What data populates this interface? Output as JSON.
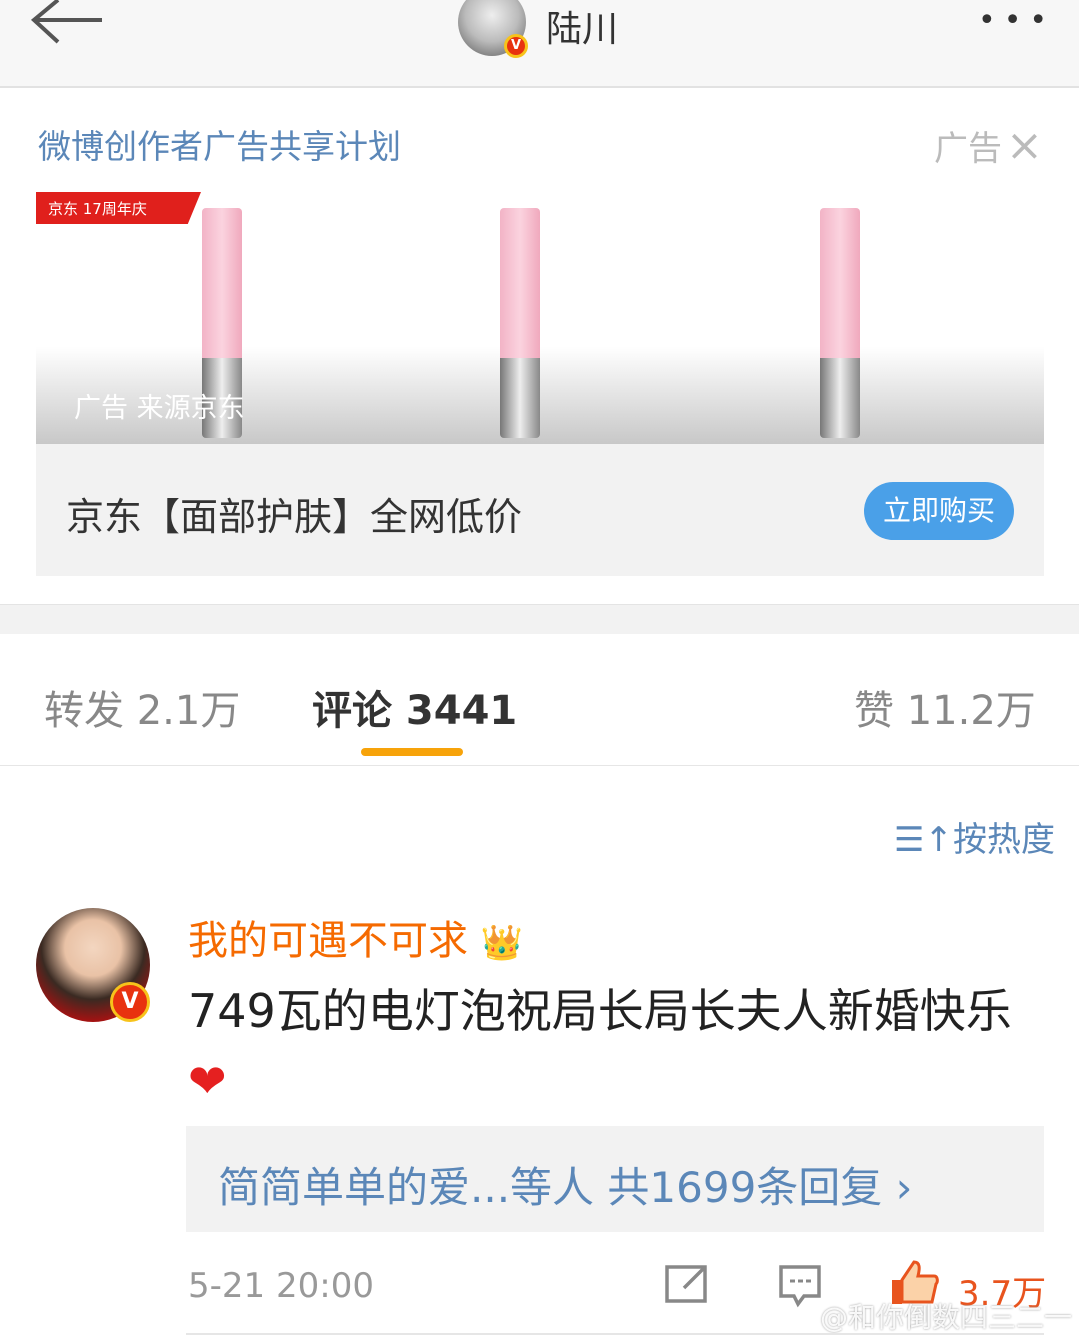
{
  "header": {
    "title": "陆川",
    "more": "•••",
    "verified": "V"
  },
  "ad": {
    "plan": "微博创作者广告共享计划",
    "tag": "广告",
    "close": "×",
    "jd_banner": "京东 17周年庆",
    "source": "广告 来源京东",
    "headline": "京东【面部护肤】全网低价",
    "buy": "立即购买"
  },
  "tabs": [
    {
      "label": "转发 2.1万"
    },
    {
      "label": "评论 3441"
    },
    {
      "label": "赞 11.2万"
    }
  ],
  "sort": "按热度",
  "comment": {
    "user": "我的可遇不可求",
    "crown": "👑",
    "text": "749瓦的电灯泡祝局长局长夫人新婚快乐",
    "heart": "❤",
    "replies": "简简单单的爱...等人  共1699条回复 ›",
    "time": "5-21 20:00",
    "likes": "3.7万"
  },
  "watermark": "@和你倒数四三二一",
  "colors": {
    "link": "#5b87b8",
    "accent": "#f7a30a",
    "like": "#e8541e"
  }
}
